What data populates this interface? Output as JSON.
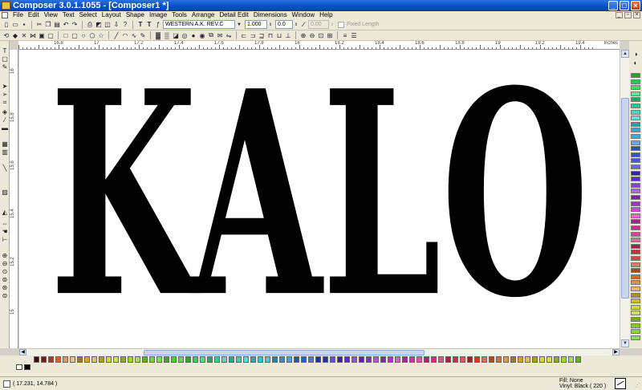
{
  "window": {
    "title": "Composer 3.0.1.1055 - [Composer1 *]",
    "min": "_",
    "max": "□",
    "close": "×"
  },
  "menu": [
    "File",
    "Edit",
    "View",
    "Text",
    "Select",
    "Layout",
    "Shape",
    "Image",
    "Tools",
    "Arrange",
    "Detail Edit",
    "Dimensions",
    "Window",
    "Help"
  ],
  "toolbar1": {
    "font_name": "WESTERN A.K. REV.C",
    "size_value": "1.000",
    "spacing_value": "0.0",
    "angle_value": "0.00",
    "fixed_length_label": "Fixed Length"
  },
  "ruler": {
    "units": "Inches",
    "top_labels": [
      "16.8",
      "17",
      "17.2",
      "17.4",
      "17.6",
      "17.8",
      "18",
      "18.2",
      "18.4",
      "18.6",
      "18.8",
      "19",
      "19.2",
      "19.4"
    ],
    "left_labels": [
      "16",
      "15.8",
      "15.6",
      "15.4",
      "15.2",
      "15"
    ]
  },
  "canvas": {
    "text": "KALO",
    "fill_color": "#000000"
  },
  "status": {
    "coordinates": "( 17.231, 14.784 )",
    "fill": "Fill: None",
    "vinyl": "Vinyl: Black ( 220 )"
  }
}
